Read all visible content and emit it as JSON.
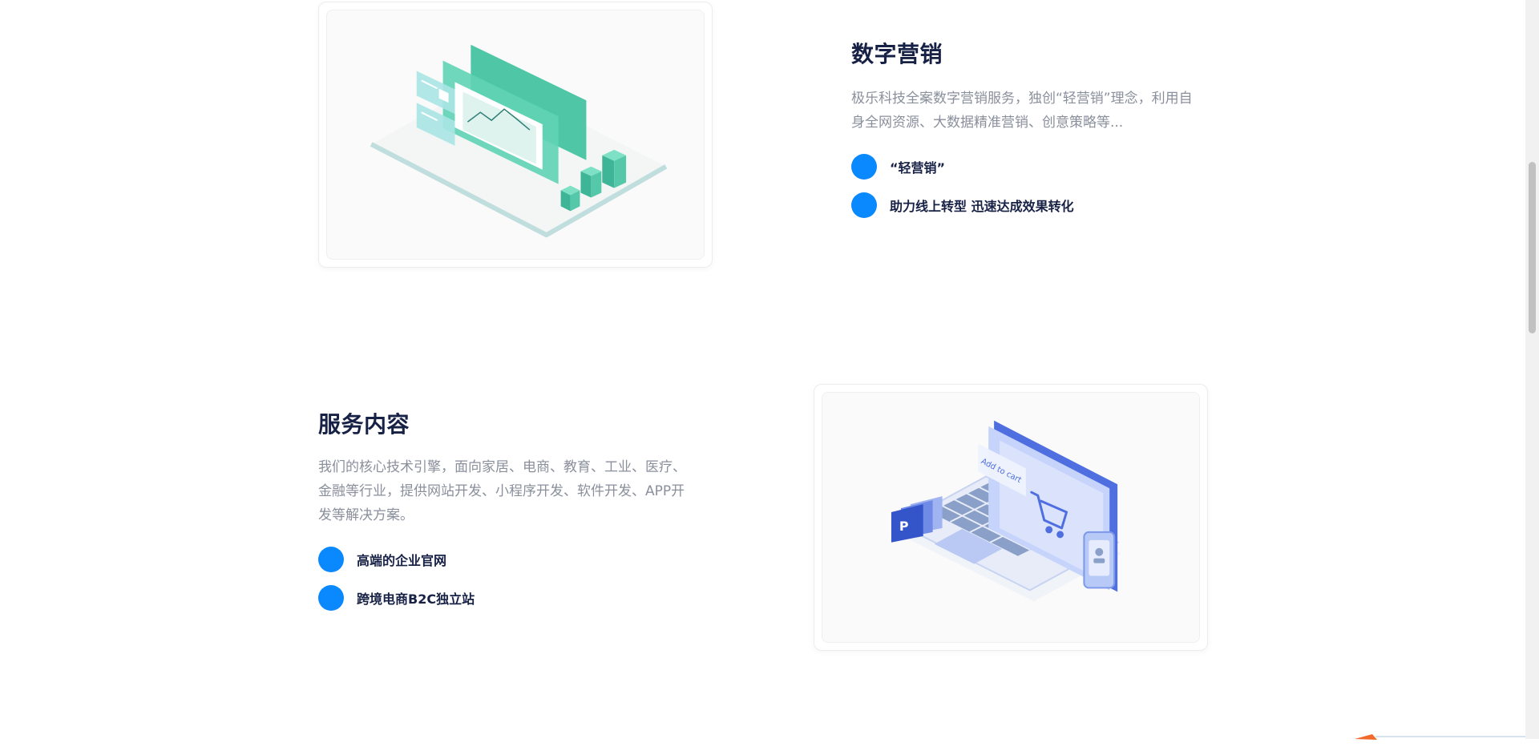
{
  "marketing": {
    "title": "数字营销",
    "description": "极乐科技全案数字营销服务，独创“轻营销”理念，利用自身全网资源、大数据精准营销、创意策略等...",
    "features": [
      {
        "label": "“轻营销”"
      },
      {
        "label": "助力线上转型 迅速达成效果转化"
      }
    ]
  },
  "service": {
    "title": "服务内容",
    "description": "我们的核心技术引擎，面向家居、电商、教育、工业、医疗、 金融等行业，提供网站开发、小程序开发、软件开发、APP开 发等解决方案。",
    "features": [
      {
        "label": "高端的企业官网"
      },
      {
        "label": "跨境电商B2C独立站"
      }
    ]
  },
  "illustration_labels": {
    "add_to_cart": "Add to cart"
  },
  "colors": {
    "accent_dot": "#0a89ff",
    "heading": "#172145",
    "body_text": "#8a8f9c",
    "teal_illustration": "#3ec9a7",
    "blue_illustration": "#5a7bea"
  },
  "icons": {
    "marketing_illustration": "data-screens-chart-icon",
    "service_illustration": "laptop-shopping-cart-icon"
  }
}
